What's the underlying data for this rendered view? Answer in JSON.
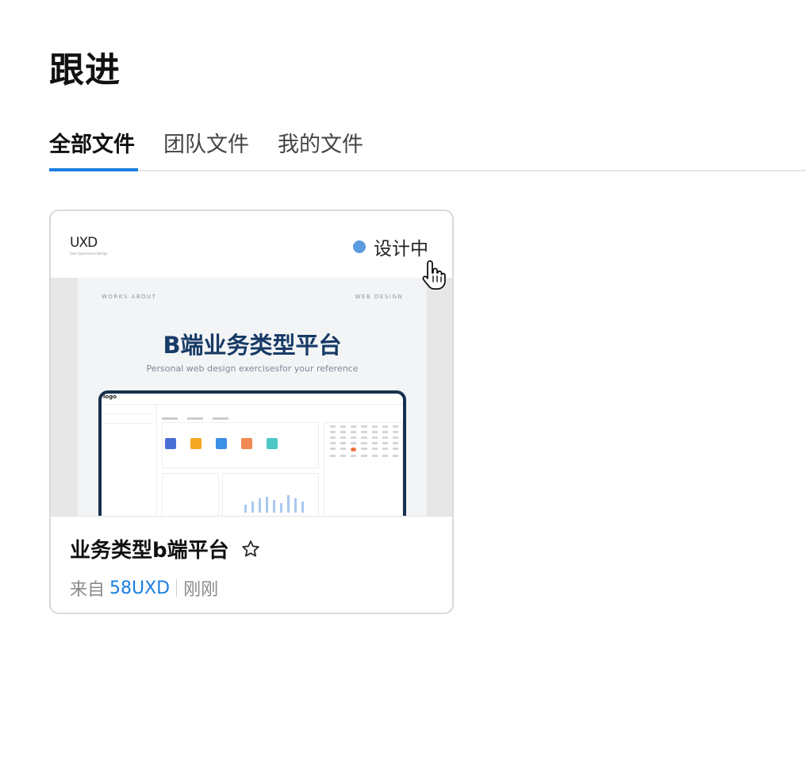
{
  "page": {
    "title": "跟进"
  },
  "tabs": [
    {
      "label": "全部文件",
      "active": true
    },
    {
      "label": "团队文件",
      "active": false
    },
    {
      "label": "我的文件",
      "active": false
    }
  ],
  "card": {
    "brand_logo": "UXD",
    "brand_logo_sub": "User Experience Design",
    "status": {
      "label": "设计中",
      "color": "#5b9be0"
    },
    "thumbnail": {
      "nav_left": "WORKS   ABOUT",
      "nav_right": "WEB   DESIGN",
      "title": "B端业务类型平台",
      "subtitle": "Personal web design exercisesfor your reference",
      "laptop_logo": "logo"
    },
    "file_name": "业务类型b端平台",
    "meta": {
      "prefix": "来自",
      "owner": "58UXD",
      "time": "刚刚"
    }
  },
  "colors": {
    "accent": "#1a7fe0",
    "thumbnail_title": "#173a66",
    "laptop_frame": "#16304f"
  },
  "icons": {
    "favorite": "star-outline-icon",
    "cursor": "hand-pointer-icon"
  }
}
